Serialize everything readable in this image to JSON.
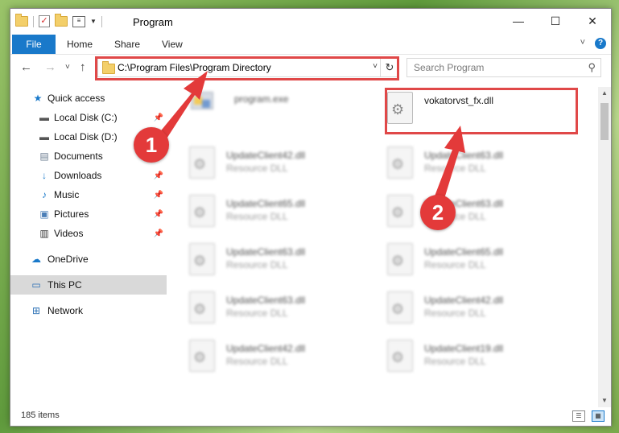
{
  "window": {
    "title": "Program",
    "controls": {
      "minimize": "—",
      "maximize": "☐",
      "close": "✕"
    }
  },
  "ribbon": {
    "tabs": [
      "File",
      "Home",
      "Share",
      "View"
    ],
    "expand": "˅",
    "help": "?"
  },
  "navigation": {
    "back": "←",
    "forward": "→",
    "recent": "˅",
    "up": "↑"
  },
  "address_bar": {
    "path": "C:\\Program Files\\Program Directory",
    "dropdown": "˅",
    "refresh": "↻"
  },
  "search": {
    "placeholder": "Search Program",
    "icon": "search-icon"
  },
  "sidebar": {
    "items": [
      {
        "label": "Quick access",
        "icon": "star-icon",
        "pinned": false
      },
      {
        "label": "Local Disk (C:)",
        "icon": "drive-icon",
        "pinned": true
      },
      {
        "label": "Local Disk (D:)",
        "icon": "drive-icon",
        "pinned": true
      },
      {
        "label": "Documents",
        "icon": "documents-icon",
        "pinned": true
      },
      {
        "label": "Downloads",
        "icon": "download-icon",
        "pinned": true
      },
      {
        "label": "Music",
        "icon": "music-icon",
        "pinned": true
      },
      {
        "label": "Pictures",
        "icon": "pictures-icon",
        "pinned": true
      },
      {
        "label": "Videos",
        "icon": "videos-icon",
        "pinned": true
      },
      {
        "label": "OneDrive",
        "icon": "cloud-icon",
        "pinned": false
      },
      {
        "label": "This PC",
        "icon": "computer-icon",
        "pinned": false,
        "selected": true
      },
      {
        "label": "Network",
        "icon": "network-icon",
        "pinned": false
      }
    ]
  },
  "files": {
    "highlighted": {
      "name": "vokatorvst_fx.dll"
    },
    "exe": {
      "name": "program.exe"
    },
    "items": [
      {
        "name": "UpdateClient42.dll",
        "type": "Resource DLL"
      },
      {
        "name": "UpdateClient63.dll",
        "type": "Resource DLL"
      },
      {
        "name": "UpdateClient65.dll",
        "type": "Resource DLL"
      },
      {
        "name": "UpdateClient63.dll",
        "type": "Resource DLL"
      },
      {
        "name": "UpdateClient63.dll",
        "type": "Resource DLL"
      },
      {
        "name": "UpdateClient65.dll",
        "type": "Resource DLL"
      },
      {
        "name": "UpdateClient63.dll",
        "type": "Resource DLL"
      },
      {
        "name": "UpdateClient42.dll",
        "type": "Resource DLL"
      },
      {
        "name": "UpdateClient42.dll",
        "type": "Resource DLL"
      },
      {
        "name": "UpdateClient19.dll",
        "type": "Resource DLL"
      }
    ]
  },
  "status": {
    "item_count": "185 items"
  },
  "annotations": {
    "step1": "1",
    "step2": "2",
    "color": "#e04848"
  }
}
